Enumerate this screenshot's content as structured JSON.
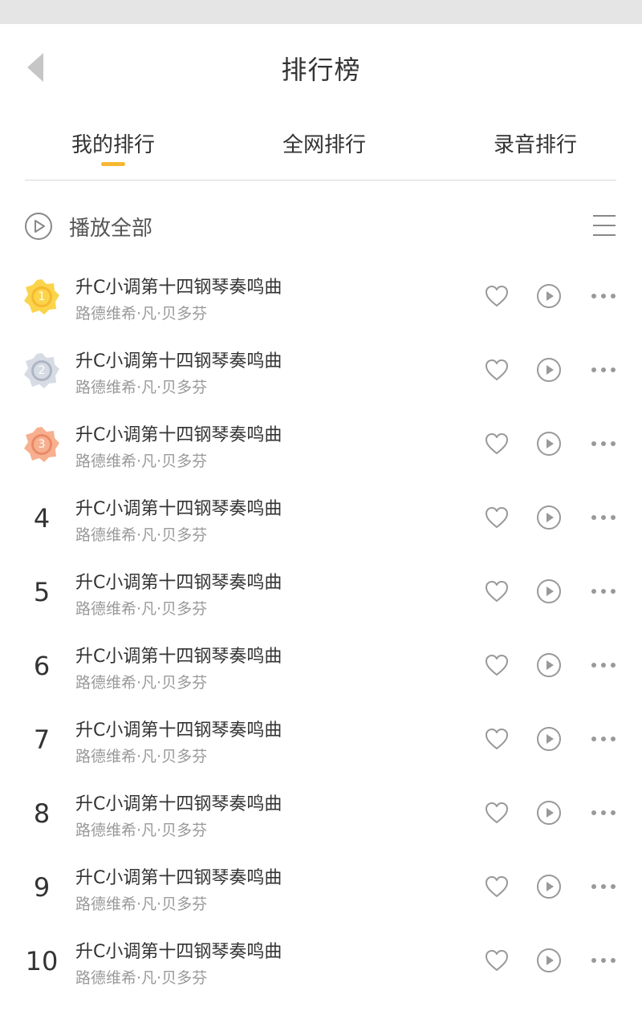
{
  "header": {
    "title": "排行榜",
    "back_icon": "chevron-left-icon"
  },
  "tabs": [
    {
      "label": "我的排行",
      "active": true
    },
    {
      "label": "全网排行",
      "active": false
    },
    {
      "label": "录音排行",
      "active": false
    }
  ],
  "colors": {
    "accent": "#f7b733",
    "gold": "#f5b324",
    "silver": "#9aa3b2",
    "bronze": "#e9825e",
    "icon_gray": "#888888"
  },
  "toolbar": {
    "play_all_label": "播放全部",
    "play_all_icon": "play-circle-icon",
    "list_icon": "list-menu-icon"
  },
  "songs": [
    {
      "rank": "1",
      "medal": "gold-medal-icon",
      "title": "升C小调第十四钢琴奏鸣曲",
      "artist": "路德维希·凡·贝多芬"
    },
    {
      "rank": "2",
      "medal": "silver-medal-icon",
      "title": "升C小调第十四钢琴奏鸣曲",
      "artist": "路德维希·凡·贝多芬"
    },
    {
      "rank": "3",
      "medal": "bronze-medal-icon",
      "title": "升C小调第十四钢琴奏鸣曲",
      "artist": "路德维希·凡·贝多芬"
    },
    {
      "rank": "4",
      "title": "升C小调第十四钢琴奏鸣曲",
      "artist": "路德维希·凡·贝多芬"
    },
    {
      "rank": "5",
      "title": "升C小调第十四钢琴奏鸣曲",
      "artist": "路德维希·凡·贝多芬"
    },
    {
      "rank": "6",
      "title": "升C小调第十四钢琴奏鸣曲",
      "artist": "路德维希·凡·贝多芬"
    },
    {
      "rank": "7",
      "title": "升C小调第十四钢琴奏鸣曲",
      "artist": "路德维希·凡·贝多芬"
    },
    {
      "rank": "8",
      "title": "升C小调第十四钢琴奏鸣曲",
      "artist": "路德维希·凡·贝多芬"
    },
    {
      "rank": "9",
      "title": "升C小调第十四钢琴奏鸣曲",
      "artist": "路德维希·凡·贝多芬"
    },
    {
      "rank": "10",
      "title": "升C小调第十四钢琴奏鸣曲",
      "artist": "路德维希·凡·贝多芬"
    }
  ]
}
